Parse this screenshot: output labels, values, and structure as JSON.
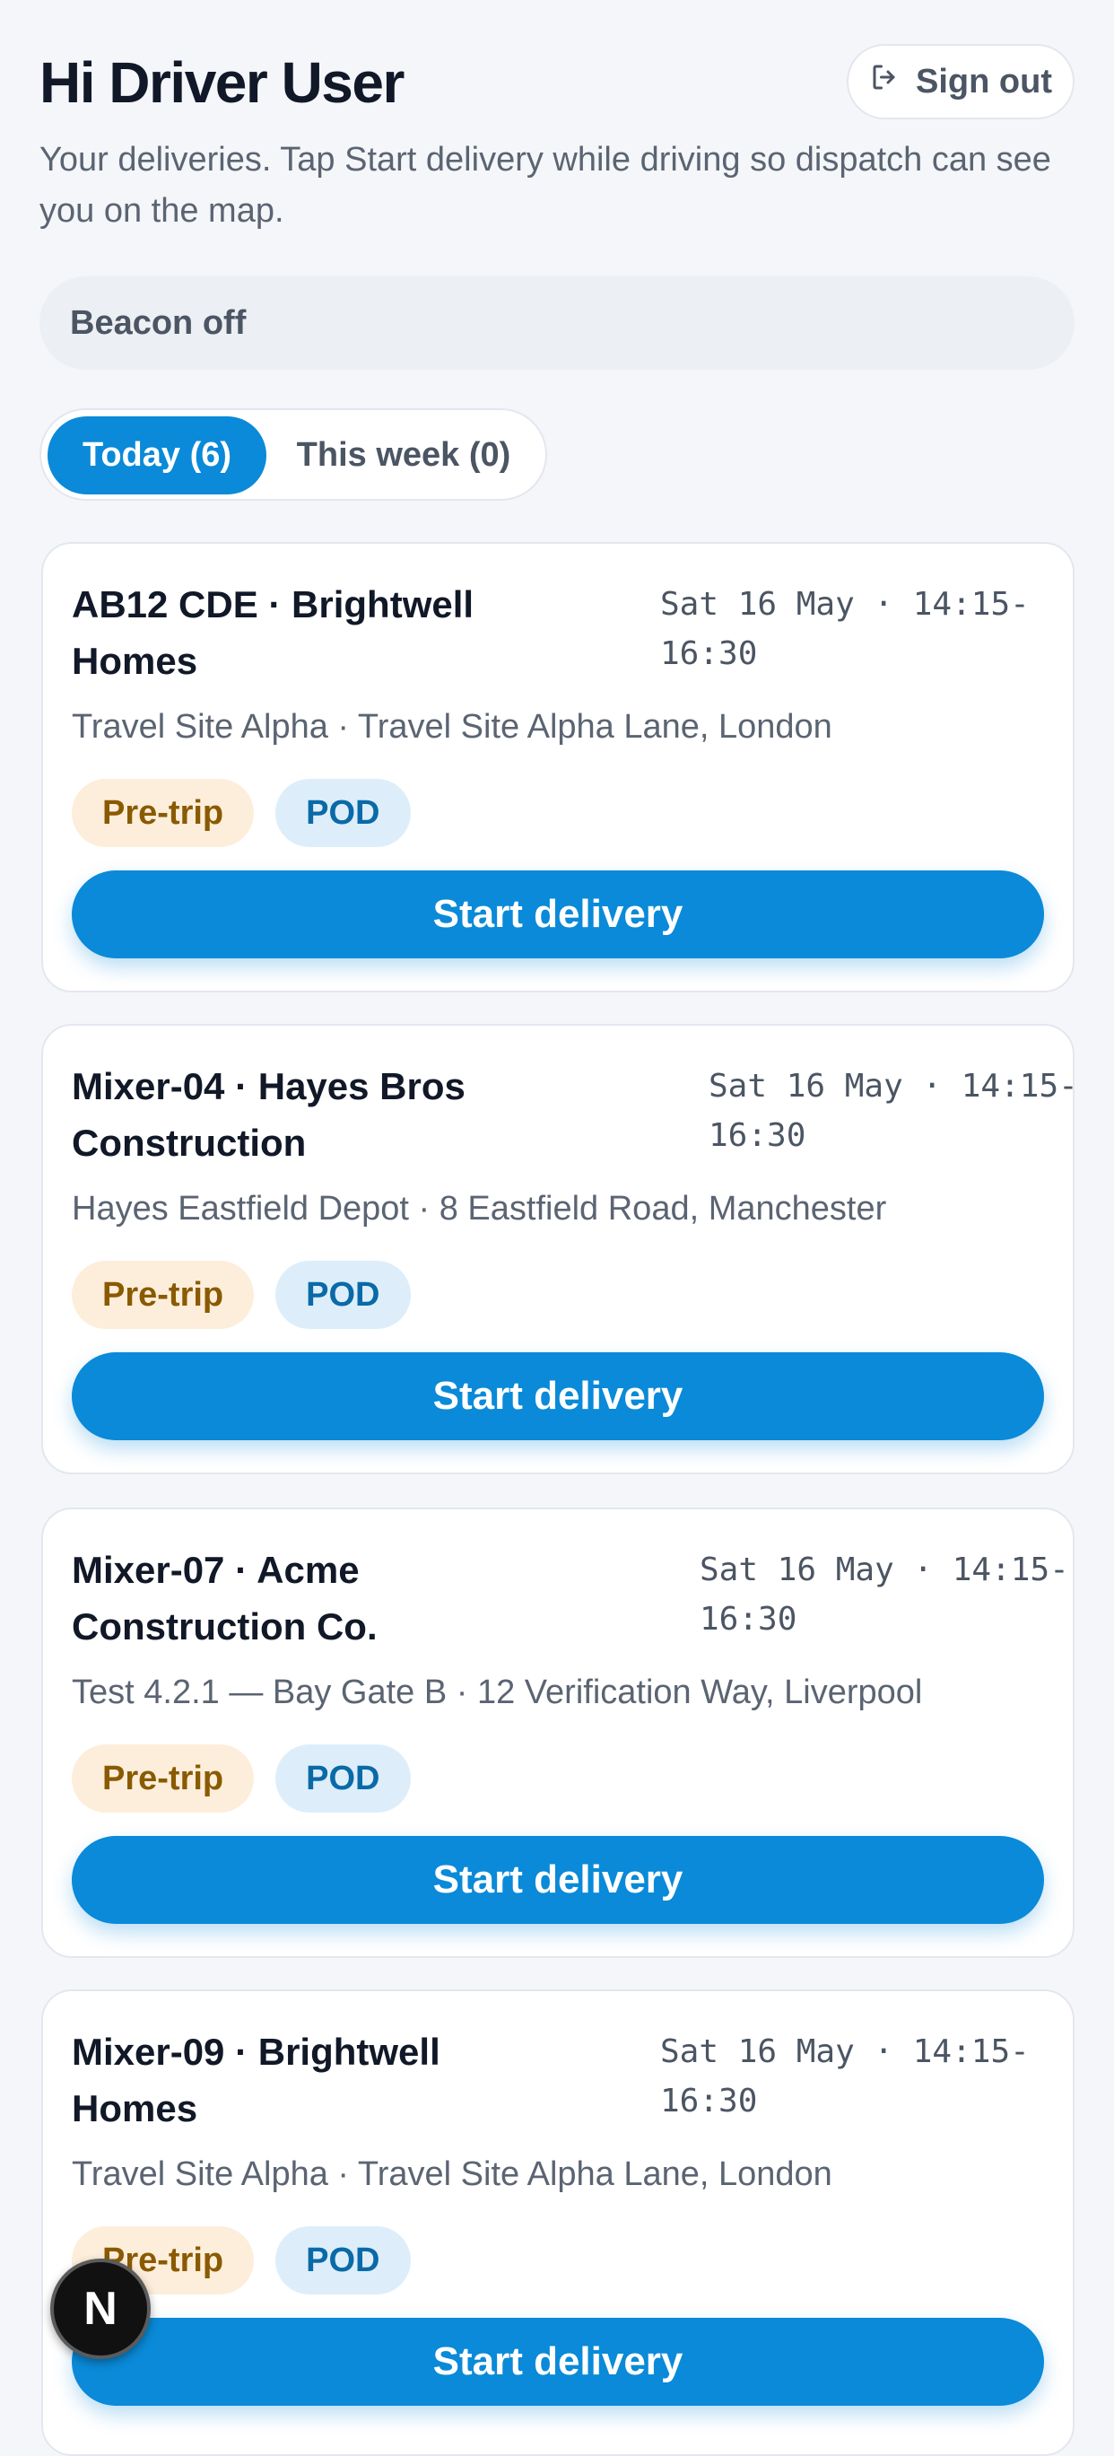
{
  "header": {
    "title": "Hi Driver User",
    "signout_label": "Sign out",
    "subtitle": "Your deliveries. Tap Start delivery while driving so dispatch can see you on the map."
  },
  "beacon": {
    "status": "Beacon off"
  },
  "tabs": [
    {
      "label": "Today (6)",
      "active": true
    },
    {
      "label": "This week (0)",
      "active": false
    }
  ],
  "deliveries": [
    {
      "title": "AB12 CDE · Brightwell Homes",
      "time": "Sat 16 May · 14:15-16:30",
      "address": "Travel Site Alpha · Travel Site Alpha Lane, London",
      "badges": [
        "Pre-trip",
        "POD"
      ],
      "action": "Start delivery"
    },
    {
      "title": "Mixer-04 · Hayes Bros Construction",
      "time": "Sat 16 May · 14:15-16:30",
      "address": "Hayes Eastfield Depot · 8 Eastfield Road, Manchester",
      "badges": [
        "Pre-trip",
        "POD"
      ],
      "action": "Start delivery"
    },
    {
      "title": "Mixer-07 · Acme Construction Co.",
      "time": "Sat 16 May · 14:15-16:30",
      "address": "Test 4.2.1 — Bay Gate B · 12 Verification Way, Liverpool",
      "badges": [
        "Pre-trip",
        "POD"
      ],
      "action": "Start delivery"
    },
    {
      "title": "Mixer-09 · Brightwell Homes",
      "time": "Sat 16 May · 14:15-16:30",
      "address": "Travel Site Alpha · Travel Site Alpha Lane, London",
      "badges": [
        "Pre-trip",
        "POD"
      ],
      "action": "Start delivery"
    }
  ],
  "fab": {
    "label": "N"
  },
  "colors": {
    "accent": "#0a8ad8",
    "background": "#f4f6f9",
    "pretrip_bg": "#fdeedb",
    "pretrip_text": "#8a5a00",
    "pod_bg": "#ddeefa",
    "pod_text": "#0a6aa8"
  }
}
